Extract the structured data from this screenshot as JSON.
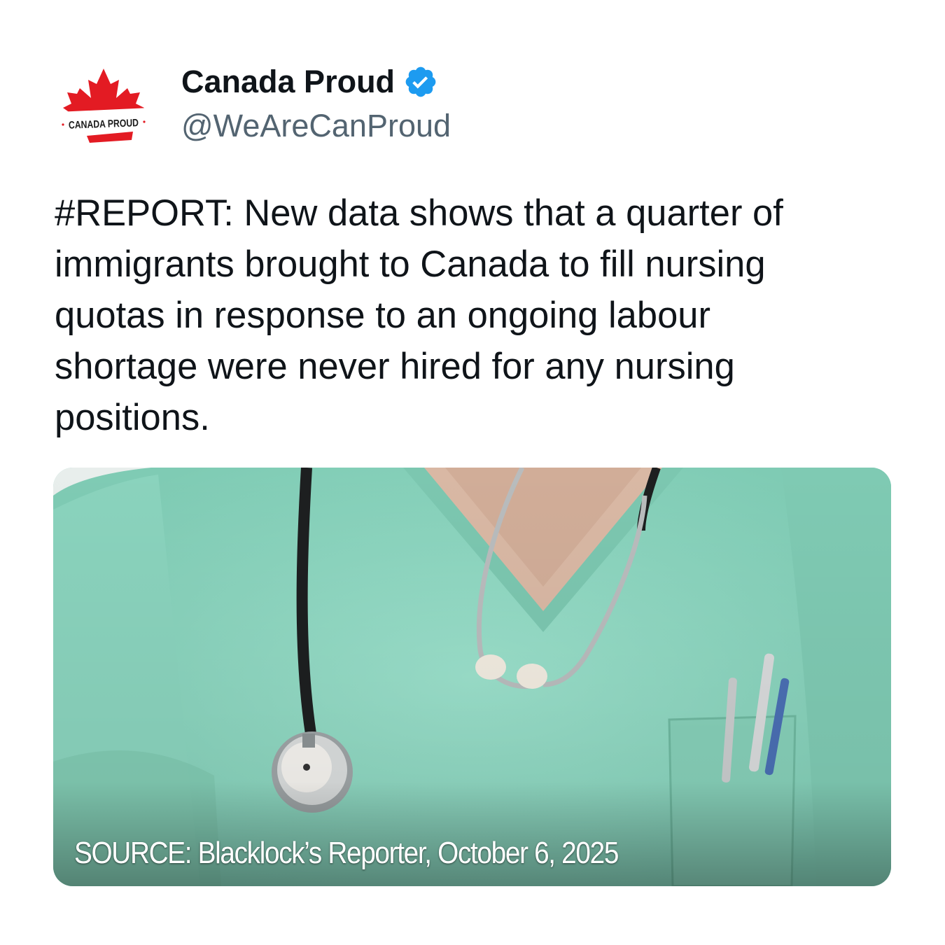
{
  "author": {
    "display_name": "Canada Proud",
    "handle": "@WeAreCanProud",
    "verified": true,
    "avatar": {
      "icon": "maple-leaf-logo-icon",
      "logo_text": "CANADA PROUD"
    }
  },
  "post": {
    "text": "#REPORT: New data shows that a quarter of\nimmigrants brought to Canada to fill nursing\nquotas in response to an ongoing labour\nshortage were never hired for any nursing\npositions."
  },
  "media": {
    "image_subject": "nurse-in-scrubs-with-stethoscope",
    "source_caption": "SOURCE: Blacklock’s Reporter, October 6, 2025"
  },
  "colors": {
    "primary_text": "#0f1419",
    "secondary_text": "#536471",
    "verified_blue": "#1d9bf0",
    "logo_red": "#e31b23",
    "scrubs_green": "#8fd6c1"
  }
}
